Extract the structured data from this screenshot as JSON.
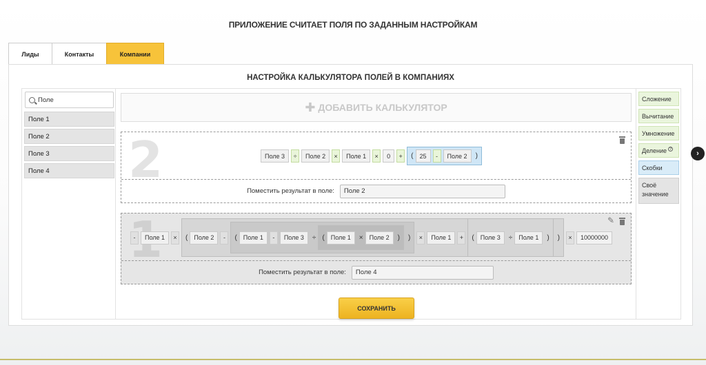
{
  "header": {
    "title": "Приложение считает поля по заданным настройкам"
  },
  "tabs": [
    {
      "label": "Лиды",
      "active": false
    },
    {
      "label": "Контакты",
      "active": false
    },
    {
      "label": "Компании",
      "active": true
    }
  ],
  "section": {
    "title": "Настройка калькулятора полей в компаниях"
  },
  "search": {
    "value": "Поле"
  },
  "fields": [
    "Поле 1",
    "Поле 2",
    "Поле 3",
    "Поле 4"
  ],
  "add_calculator": {
    "label": "Добавить калькулятор"
  },
  "calculators": [
    {
      "number": "2",
      "tokens": [
        "Поле 3",
        "÷",
        "Поле 2",
        "×",
        "Поле 1",
        "×",
        "0",
        "+",
        "(",
        "25",
        "-",
        "Поле 2",
        ")"
      ],
      "result_label": "Поместить результат в поле:",
      "result_value": "Поле 2"
    },
    {
      "number": "1",
      "tokens": [
        "-",
        "Поле 1",
        "×",
        "(",
        "Поле 2",
        "-",
        "(",
        "Поле 1",
        "-",
        "Поле 3",
        "÷",
        "(",
        "Поле 1",
        "×",
        "Поле 2",
        ")",
        ")",
        "×",
        "Поле 1",
        "+",
        "(",
        "Поле 3",
        "÷",
        "Поле 1",
        ")",
        ")",
        "×",
        "10000000"
      ],
      "result_label": "Поместить результат в поле:",
      "result_value": "Поле 4"
    }
  ],
  "operations": [
    "Сложение",
    "Вычитание",
    "Умножение",
    "Деление",
    "Скобки",
    "Своё значение"
  ],
  "save": {
    "label": "Сохранить"
  },
  "colors": {
    "accent": "#f7c33a",
    "op_green": "#eaf5dd",
    "brackets_blue": "#d9ecf8"
  }
}
